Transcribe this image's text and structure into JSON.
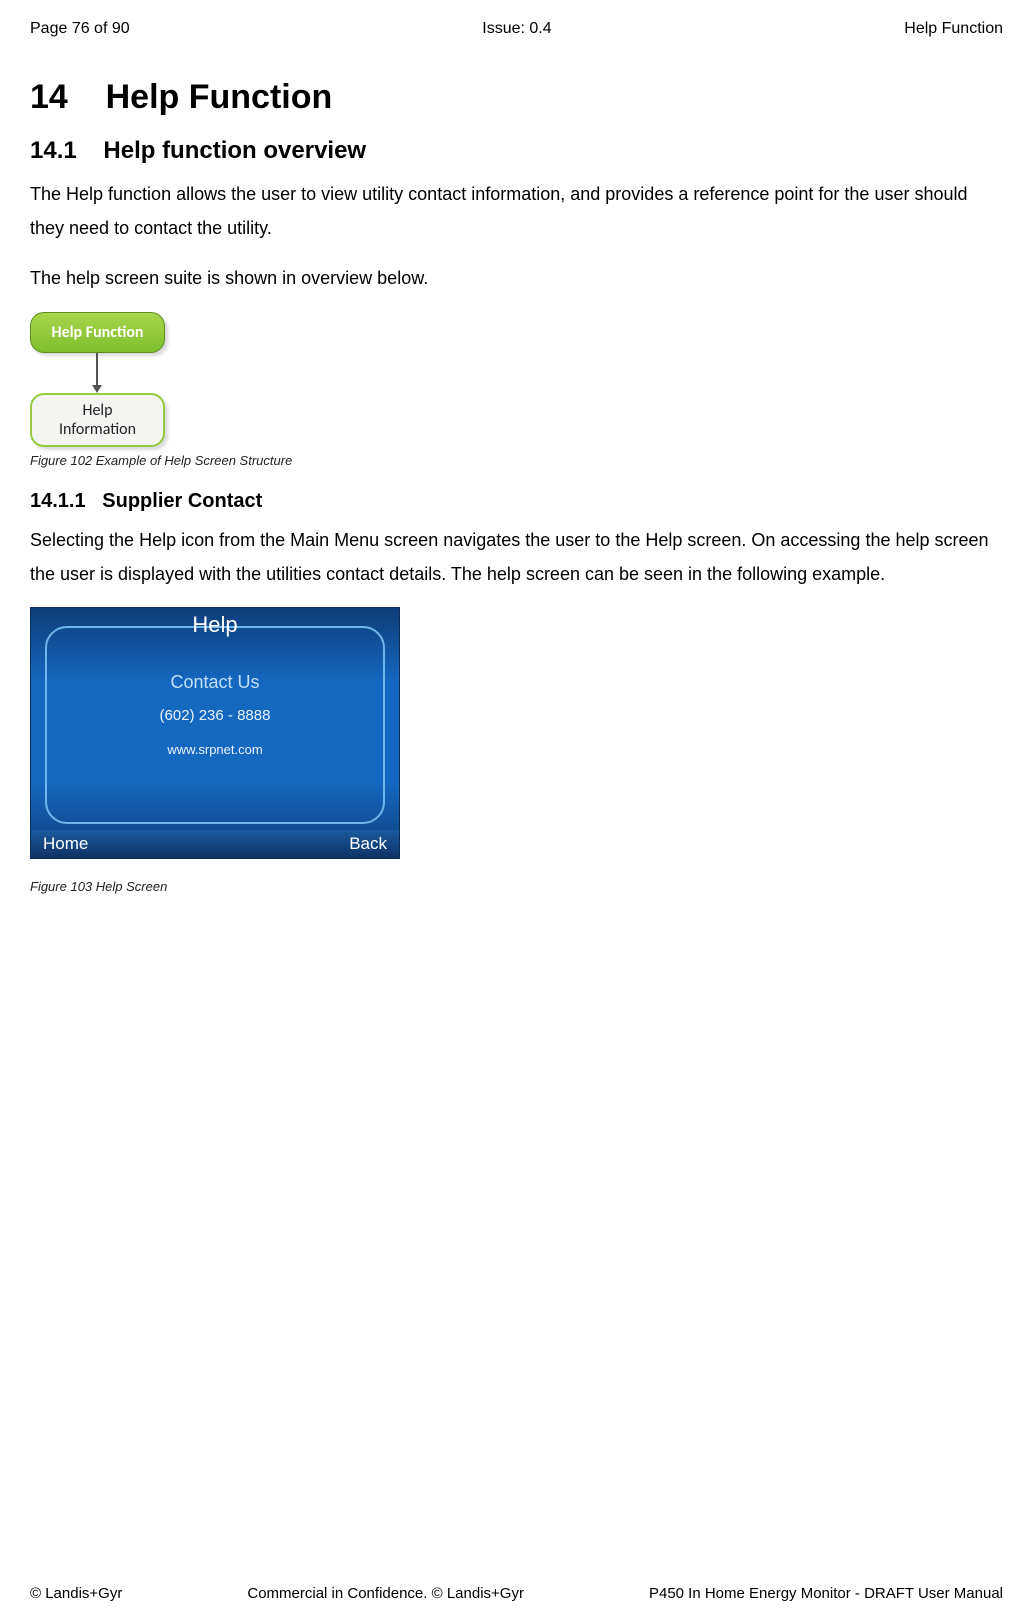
{
  "header": {
    "left": "Page 76 of 90",
    "center": "Issue: 0.4",
    "right": "Help Function"
  },
  "chapter": {
    "number": "14",
    "title": "Help Function"
  },
  "section_14_1": {
    "number": "14.1",
    "title": "Help function overview",
    "para1": "The Help function allows the user to view utility contact information, and provides a reference point for the user should they need to contact the utility.",
    "para2": "The help screen suite is shown in overview below."
  },
  "diagram": {
    "top_label": "Help Function",
    "bottom_label_line1": "Help",
    "bottom_label_line2": "Information",
    "caption": "Figure 102 Example of Help Screen Structure"
  },
  "section_14_1_1": {
    "number": "14.1.1",
    "title": "Supplier Contact",
    "para1": "Selecting the Help icon from the Main Menu screen navigates the user to the Help screen. On accessing the help screen the user is displayed with the utilities contact details. The help screen can be seen in the following example."
  },
  "help_screen": {
    "title": "Help",
    "subtitle": "Contact Us",
    "phone": "(602) 236 - 8888",
    "url": "www.srpnet.com",
    "home": "Home",
    "back": "Back",
    "caption": "Figure 103 Help Screen"
  },
  "footer": {
    "left": "© Landis+Gyr",
    "center": "Commercial in Confidence. © Landis+Gyr",
    "right": "P450 In Home Energy Monitor - DRAFT User Manual"
  }
}
